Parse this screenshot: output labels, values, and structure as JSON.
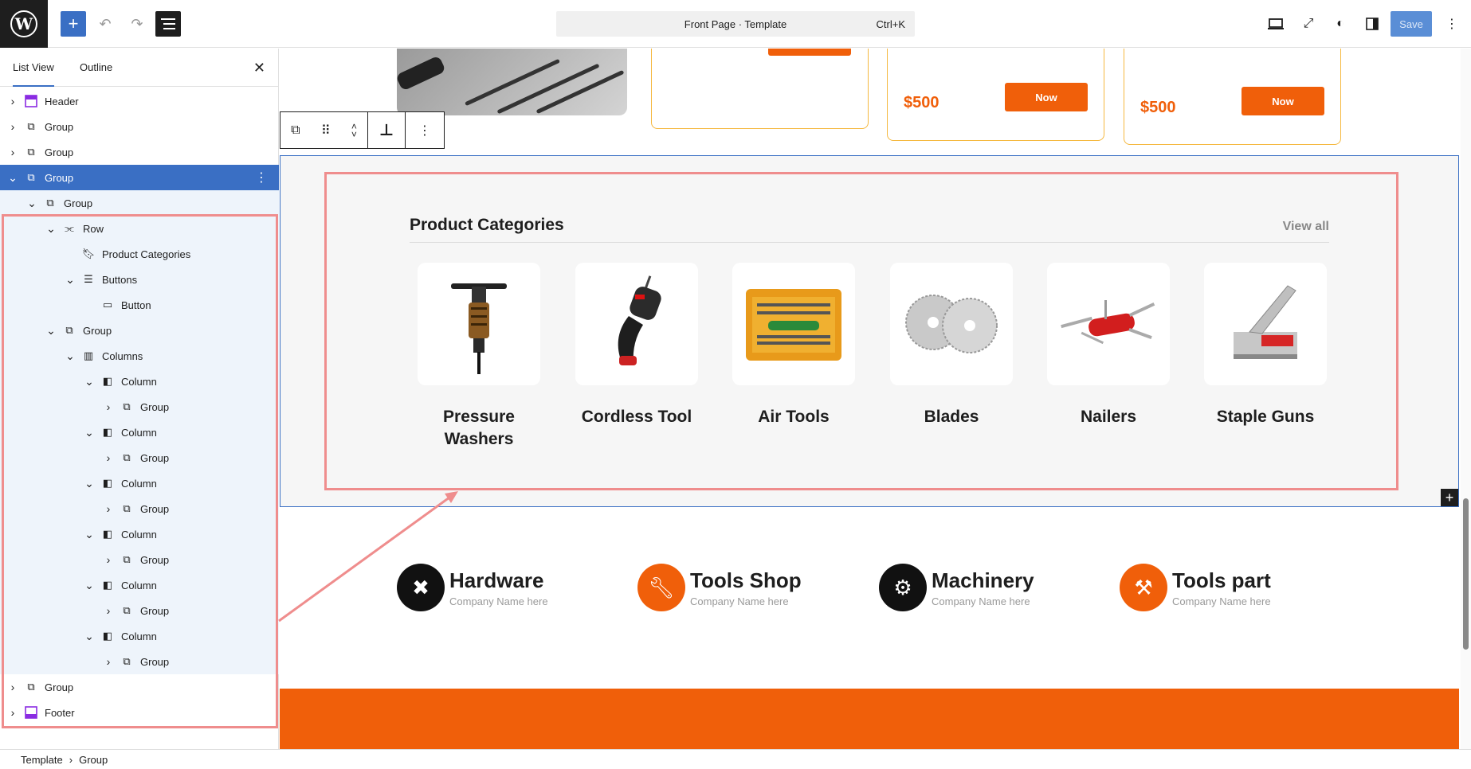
{
  "topbar": {
    "command_title": "Front Page · Template",
    "command_shortcut": "Ctrl+K",
    "save_label": "Save"
  },
  "sidebar": {
    "tabs": [
      "List View",
      "Outline"
    ],
    "tree": [
      {
        "label": "Header",
        "icon": "header-icon"
      },
      {
        "label": "Group",
        "icon": "group-icon"
      },
      {
        "label": "Group",
        "icon": "group-icon"
      },
      {
        "label": "Group",
        "icon": "group-icon"
      },
      {
        "label": "Group",
        "icon": "group-icon"
      },
      {
        "label": "Row",
        "icon": "row-icon"
      },
      {
        "label": "Product Categories",
        "icon": "bookmark-icon"
      },
      {
        "label": "Buttons",
        "icon": "buttons-icon"
      },
      {
        "label": "Button",
        "icon": "button-icon"
      },
      {
        "label": "Group",
        "icon": "group-icon"
      },
      {
        "label": "Columns",
        "icon": "columns-icon"
      },
      {
        "label": "Column",
        "icon": "column-icon"
      },
      {
        "label": "Group",
        "icon": "group-icon"
      },
      {
        "label": "Column",
        "icon": "column-icon"
      },
      {
        "label": "Group",
        "icon": "group-icon"
      },
      {
        "label": "Column",
        "icon": "column-icon"
      },
      {
        "label": "Group",
        "icon": "group-icon"
      },
      {
        "label": "Column",
        "icon": "column-icon"
      },
      {
        "label": "Group",
        "icon": "group-icon"
      },
      {
        "label": "Column",
        "icon": "column-icon"
      },
      {
        "label": "Group",
        "icon": "group-icon"
      },
      {
        "label": "Column",
        "icon": "column-icon"
      },
      {
        "label": "Group",
        "icon": "group-icon"
      },
      {
        "label": "Group",
        "icon": "group-icon"
      },
      {
        "label": "Footer",
        "icon": "footer-icon"
      }
    ]
  },
  "breadcrumb": {
    "items": [
      "Template",
      "Group"
    ]
  },
  "canvas": {
    "prices": [
      "$500",
      "$500"
    ],
    "shop_now": [
      "Now",
      "Now"
    ],
    "product_categories": {
      "title": "Product Categories",
      "view_all": "View all",
      "items": [
        {
          "name": "Pressure Washers",
          "icon": "jackhammer-icon"
        },
        {
          "name": "Cordless Tool",
          "icon": "drill-icon"
        },
        {
          "name": "Air Tools",
          "icon": "toolbox-icon"
        },
        {
          "name": "Blades",
          "icon": "saw-blade-icon"
        },
        {
          "name": "Nailers",
          "icon": "multitool-icon"
        },
        {
          "name": "Staple Guns",
          "icon": "staple-gun-icon"
        }
      ]
    },
    "features": [
      {
        "title": "Hardware",
        "subtitle": "Company Name here",
        "icon": "tools-icon",
        "color": "#111111"
      },
      {
        "title": "Tools Shop",
        "subtitle": "Company Name here",
        "icon": "wrench-icon",
        "color": "#f05f0a"
      },
      {
        "title": "Machinery",
        "subtitle": "Company Name here",
        "icon": "gear-icon",
        "color": "#111111"
      },
      {
        "title": "Tools part",
        "subtitle": "Company Name here",
        "icon": "hammer-icon",
        "color": "#f05f0a"
      }
    ]
  },
  "colors": {
    "accent": "#3a6fc4",
    "brand_orange": "#f05f0a",
    "highlight": "#ef8d8d"
  }
}
